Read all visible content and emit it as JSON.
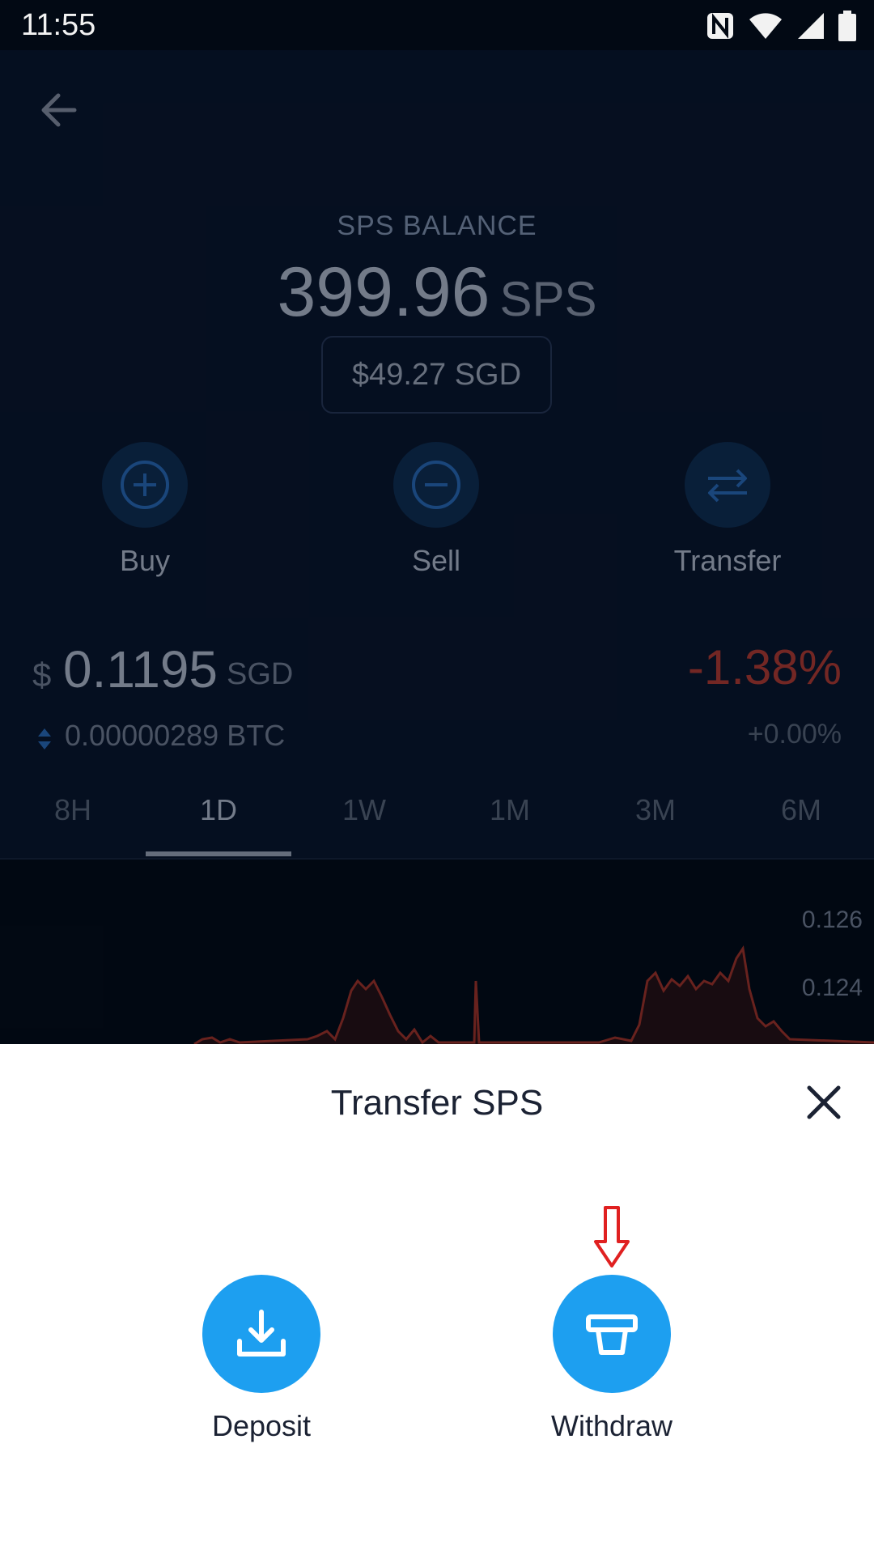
{
  "status": {
    "time": "11:55"
  },
  "balance": {
    "label": "SPS BALANCE",
    "amount": "399.96",
    "unit": "SPS",
    "fiat": "$49.27 SGD"
  },
  "actions": [
    {
      "label": "Buy",
      "icon": "plus-circle-icon"
    },
    {
      "label": "Sell",
      "icon": "minus-circle-icon"
    },
    {
      "label": "Transfer",
      "icon": "swap-arrows-icon"
    }
  ],
  "price": {
    "currency_symbol": "$",
    "value": "0.1195",
    "unit": "SGD",
    "change": "-1.38%",
    "btc_value": "0.00000289 BTC",
    "btc_change": "+0.00%"
  },
  "tabs": [
    "8H",
    "1D",
    "1W",
    "1M",
    "3M",
    "6M"
  ],
  "active_tab": "1D",
  "chart_data": {
    "type": "line",
    "y_tick_labels": [
      "0.126",
      "0.124"
    ],
    "color": "#c0392b"
  },
  "sheet": {
    "title": "Transfer SPS",
    "actions": [
      {
        "label": "Deposit",
        "icon": "download-tray-icon"
      },
      {
        "label": "Withdraw",
        "icon": "atm-withdraw-icon"
      }
    ]
  },
  "colors": {
    "accent": "#1d9ff0",
    "negative": "#c0392b",
    "hint_arrow": "#e02020"
  }
}
